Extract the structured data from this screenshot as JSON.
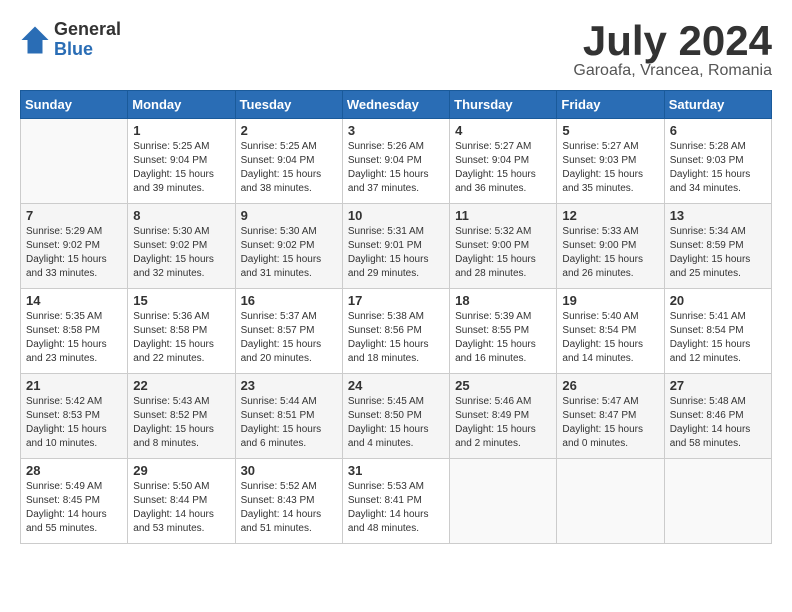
{
  "logo": {
    "general": "General",
    "blue": "Blue"
  },
  "title": "July 2024",
  "subtitle": "Garoafa, Vrancea, Romania",
  "headers": [
    "Sunday",
    "Monday",
    "Tuesday",
    "Wednesday",
    "Thursday",
    "Friday",
    "Saturday"
  ],
  "weeks": [
    [
      {
        "day": "",
        "info": ""
      },
      {
        "day": "1",
        "info": "Sunrise: 5:25 AM\nSunset: 9:04 PM\nDaylight: 15 hours\nand 39 minutes."
      },
      {
        "day": "2",
        "info": "Sunrise: 5:25 AM\nSunset: 9:04 PM\nDaylight: 15 hours\nand 38 minutes."
      },
      {
        "day": "3",
        "info": "Sunrise: 5:26 AM\nSunset: 9:04 PM\nDaylight: 15 hours\nand 37 minutes."
      },
      {
        "day": "4",
        "info": "Sunrise: 5:27 AM\nSunset: 9:04 PM\nDaylight: 15 hours\nand 36 minutes."
      },
      {
        "day": "5",
        "info": "Sunrise: 5:27 AM\nSunset: 9:03 PM\nDaylight: 15 hours\nand 35 minutes."
      },
      {
        "day": "6",
        "info": "Sunrise: 5:28 AM\nSunset: 9:03 PM\nDaylight: 15 hours\nand 34 minutes."
      }
    ],
    [
      {
        "day": "7",
        "info": "Sunrise: 5:29 AM\nSunset: 9:02 PM\nDaylight: 15 hours\nand 33 minutes."
      },
      {
        "day": "8",
        "info": "Sunrise: 5:30 AM\nSunset: 9:02 PM\nDaylight: 15 hours\nand 32 minutes."
      },
      {
        "day": "9",
        "info": "Sunrise: 5:30 AM\nSunset: 9:02 PM\nDaylight: 15 hours\nand 31 minutes."
      },
      {
        "day": "10",
        "info": "Sunrise: 5:31 AM\nSunset: 9:01 PM\nDaylight: 15 hours\nand 29 minutes."
      },
      {
        "day": "11",
        "info": "Sunrise: 5:32 AM\nSunset: 9:00 PM\nDaylight: 15 hours\nand 28 minutes."
      },
      {
        "day": "12",
        "info": "Sunrise: 5:33 AM\nSunset: 9:00 PM\nDaylight: 15 hours\nand 26 minutes."
      },
      {
        "day": "13",
        "info": "Sunrise: 5:34 AM\nSunset: 8:59 PM\nDaylight: 15 hours\nand 25 minutes."
      }
    ],
    [
      {
        "day": "14",
        "info": "Sunrise: 5:35 AM\nSunset: 8:58 PM\nDaylight: 15 hours\nand 23 minutes."
      },
      {
        "day": "15",
        "info": "Sunrise: 5:36 AM\nSunset: 8:58 PM\nDaylight: 15 hours\nand 22 minutes."
      },
      {
        "day": "16",
        "info": "Sunrise: 5:37 AM\nSunset: 8:57 PM\nDaylight: 15 hours\nand 20 minutes."
      },
      {
        "day": "17",
        "info": "Sunrise: 5:38 AM\nSunset: 8:56 PM\nDaylight: 15 hours\nand 18 minutes."
      },
      {
        "day": "18",
        "info": "Sunrise: 5:39 AM\nSunset: 8:55 PM\nDaylight: 15 hours\nand 16 minutes."
      },
      {
        "day": "19",
        "info": "Sunrise: 5:40 AM\nSunset: 8:54 PM\nDaylight: 15 hours\nand 14 minutes."
      },
      {
        "day": "20",
        "info": "Sunrise: 5:41 AM\nSunset: 8:54 PM\nDaylight: 15 hours\nand 12 minutes."
      }
    ],
    [
      {
        "day": "21",
        "info": "Sunrise: 5:42 AM\nSunset: 8:53 PM\nDaylight: 15 hours\nand 10 minutes."
      },
      {
        "day": "22",
        "info": "Sunrise: 5:43 AM\nSunset: 8:52 PM\nDaylight: 15 hours\nand 8 minutes."
      },
      {
        "day": "23",
        "info": "Sunrise: 5:44 AM\nSunset: 8:51 PM\nDaylight: 15 hours\nand 6 minutes."
      },
      {
        "day": "24",
        "info": "Sunrise: 5:45 AM\nSunset: 8:50 PM\nDaylight: 15 hours\nand 4 minutes."
      },
      {
        "day": "25",
        "info": "Sunrise: 5:46 AM\nSunset: 8:49 PM\nDaylight: 15 hours\nand 2 minutes."
      },
      {
        "day": "26",
        "info": "Sunrise: 5:47 AM\nSunset: 8:47 PM\nDaylight: 15 hours\nand 0 minutes."
      },
      {
        "day": "27",
        "info": "Sunrise: 5:48 AM\nSunset: 8:46 PM\nDaylight: 14 hours\nand 58 minutes."
      }
    ],
    [
      {
        "day": "28",
        "info": "Sunrise: 5:49 AM\nSunset: 8:45 PM\nDaylight: 14 hours\nand 55 minutes."
      },
      {
        "day": "29",
        "info": "Sunrise: 5:50 AM\nSunset: 8:44 PM\nDaylight: 14 hours\nand 53 minutes."
      },
      {
        "day": "30",
        "info": "Sunrise: 5:52 AM\nSunset: 8:43 PM\nDaylight: 14 hours\nand 51 minutes."
      },
      {
        "day": "31",
        "info": "Sunrise: 5:53 AM\nSunset: 8:41 PM\nDaylight: 14 hours\nand 48 minutes."
      },
      {
        "day": "",
        "info": ""
      },
      {
        "day": "",
        "info": ""
      },
      {
        "day": "",
        "info": ""
      }
    ]
  ]
}
